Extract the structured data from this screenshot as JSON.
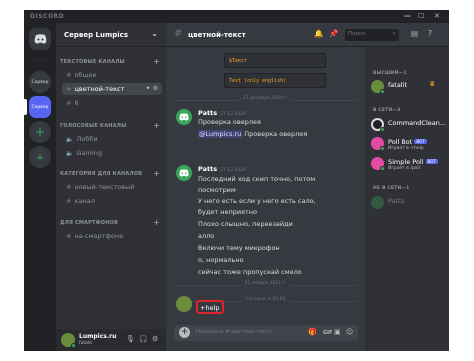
{
  "window": {
    "brand": "DISCORD",
    "controls": [
      "—",
      "☐",
      "✕"
    ]
  },
  "servers": [
    {
      "label": "Сервер"
    },
    {
      "label": "Сервер"
    },
    {
      "label": "+"
    },
    {
      "label": "⌖"
    }
  ],
  "sidebar": {
    "guild_name": "Сервер Lumpics",
    "categories": [
      {
        "label": "ТЕКСТОВЫЕ КАНАЛЫ",
        "plus": "+"
      },
      {
        "label": "ГОЛОСОВЫЕ КАНАЛЫ",
        "plus": "+"
      },
      {
        "label": "КАТЕГОРИЯ ДЛЯ КАНАЛОВ",
        "plus": "+"
      },
      {
        "label": "ДЛЯ СМАРТФОНОВ",
        "plus": "+"
      }
    ],
    "channels": [
      {
        "label": "общее",
        "type": "text"
      },
      {
        "label": "цветной-текст",
        "type": "text",
        "selected": true
      },
      {
        "label": "6",
        "type": "text"
      },
      {
        "label": "Лобби",
        "type": "voice"
      },
      {
        "label": "Gaming",
        "type": "voice"
      },
      {
        "label": "новый-текстовый",
        "type": "text"
      },
      {
        "label": "канал",
        "type": "text"
      },
      {
        "label": "на-смартфоне",
        "type": "text"
      }
    ],
    "user": {
      "name": "Lumpics.ru",
      "tag": "fatalit"
    }
  },
  "header": {
    "channel_name": "цветной-текст",
    "search_placeholder": "Поиск"
  },
  "messages": {
    "code_block": {
      "keyword": "$Текст",
      "text": "Text (only english)"
    },
    "dividers": [
      "27 декабря 2020 г.",
      "31 января 2021 г.",
      "Сегодня, в 03:03"
    ],
    "groups": [
      {
        "author": "Patts",
        "timestamp": "27.12.2020",
        "lines": [
          "Проверка оверлея",
          "@Lumpics.ru Проверка оверлея"
        ]
      },
      {
        "author": "Patts",
        "timestamp": "27.12.2020",
        "lines": [
          "Последний ход скип точно, потом",
          "посмотрим",
          "У него есть если у него есть сало,",
          "будет неприятно",
          "Плохо слышно, переезайди",
          "алло",
          "Включи тему микрофон",
          "о, нормально",
          "сейчас тоже пропускай смело"
        ]
      }
    ],
    "own_message": "+help"
  },
  "composer": {
    "placeholder": "Написать #цветной-текст"
  },
  "members": {
    "categories": [
      "ВЫСШИЙ—1",
      "В СЕТИ—3",
      "НЕ В СЕТИ—1"
    ],
    "list": [
      {
        "name": "fatalit",
        "status": "",
        "owner": true,
        "color": "#6a8c3e"
      },
      {
        "name": "CommandClean...",
        "status": "",
        "color": "#dcddde"
      },
      {
        "name": "Poll Bot",
        "status": "Играет в +help",
        "bot": "BOT",
        "color": "#e34aa4"
      },
      {
        "name": "Simple Poll",
        "status": "Играет в /poll",
        "bot": "BOT",
        "color": "#e34aa4"
      },
      {
        "name": "Patts",
        "status": "",
        "color": "#3ba55d"
      }
    ]
  },
  "colors": {
    "accent": "#5865f2",
    "online": "#3ba55d",
    "highlight": "#e0242d"
  }
}
